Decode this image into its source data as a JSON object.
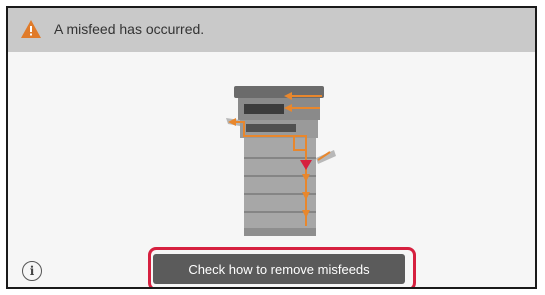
{
  "alert": {
    "icon": "warning-icon",
    "message": "A misfeed has occurred.",
    "icon_color": "#e07b2a"
  },
  "illustration": {
    "icon": "printer-misfeed-icon",
    "path_color": "#e8872d",
    "marker_color": "#d6203f"
  },
  "footer": {
    "info_icon": "info-icon",
    "info_label": "i",
    "action_label": "Check how to remove misfeeds",
    "highlight_color": "#d6203f"
  }
}
